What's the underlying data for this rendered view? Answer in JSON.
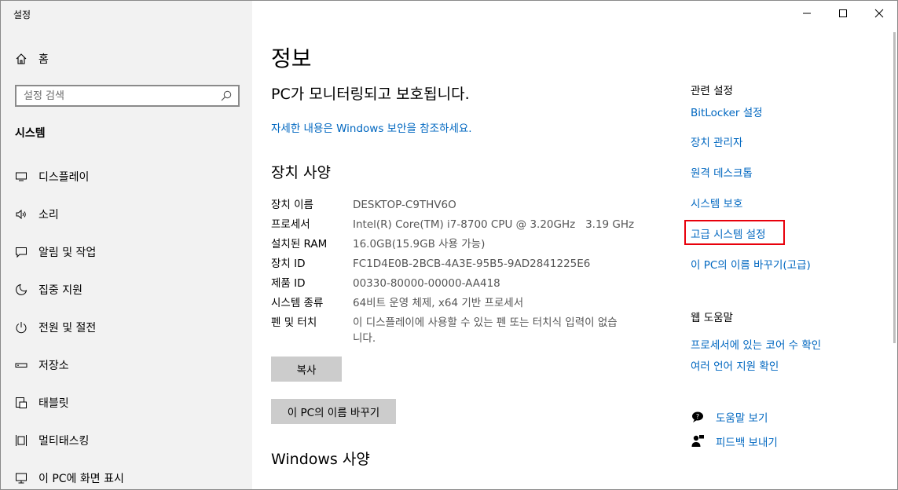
{
  "window": {
    "title": "설정"
  },
  "sidebar": {
    "home_label": "홈",
    "search_placeholder": "설정 검색",
    "section_label": "시스템",
    "items": [
      {
        "label": "디스플레이",
        "icon": "display-icon"
      },
      {
        "label": "소리",
        "icon": "sound-icon"
      },
      {
        "label": "알림 및 작업",
        "icon": "notification-icon"
      },
      {
        "label": "집중 지원",
        "icon": "focus-assist-icon"
      },
      {
        "label": "전원 및 절전",
        "icon": "power-icon"
      },
      {
        "label": "저장소",
        "icon": "storage-icon"
      },
      {
        "label": "태블릿",
        "icon": "tablet-icon"
      },
      {
        "label": "멀티태스킹",
        "icon": "multitasking-icon"
      },
      {
        "label": "이 PC에 화면 표시",
        "icon": "project-icon"
      }
    ]
  },
  "main": {
    "title": "정보",
    "protect_heading": "PC가 모니터링되고 보호됩니다.",
    "protect_link": "자세한 내용은 Windows 보안을 참조하세요.",
    "device_heading": "장치 사양",
    "specs": [
      {
        "key": "장치 이름",
        "value": "DESKTOP-C9THV6O"
      },
      {
        "key": "프로세서",
        "value": "Intel(R) Core(TM) i7-8700 CPU @ 3.20GHz   3.19 GHz"
      },
      {
        "key": "설치된 RAM",
        "value": "16.0GB(15.9GB 사용 가능)"
      },
      {
        "key": "장치 ID",
        "value": "FC1D4E0B-2BCB-4A3E-95B5-9AD2841225E6"
      },
      {
        "key": "제품 ID",
        "value": "00330-80000-00000-AA418"
      },
      {
        "key": "시스템 종류",
        "value": "64비트 운영 체제, x64 기반 프로세서"
      },
      {
        "key": "펜 및 터치",
        "value": "이 디스플레이에 사용할 수 있는 펜 또는 터치식 입력이 없습니다."
      }
    ],
    "copy_button": "복사",
    "rename_button": "이 PC의 이름 바꾸기",
    "windows_heading": "Windows 사양"
  },
  "related": {
    "heading": "관련 설정",
    "links": [
      "BitLocker 설정",
      "장치 관리자",
      "원격 데스크톱",
      "시스템 보호",
      "고급 시스템 설정",
      "이 PC의 이름 바꾸기(고급)"
    ],
    "highlight_color": "#e8000b"
  },
  "web_help": {
    "heading": "웹 도움말",
    "links": [
      "프로세서에 있는 코어 수 확인",
      "여러 언어 지원 확인"
    ]
  },
  "help": {
    "get_help": "도움말 보기",
    "feedback": "피드백 보내기"
  },
  "colors": {
    "link": "#0067c0",
    "sidebar_bg": "#f2f2f2",
    "button_bg": "#cccccc"
  }
}
